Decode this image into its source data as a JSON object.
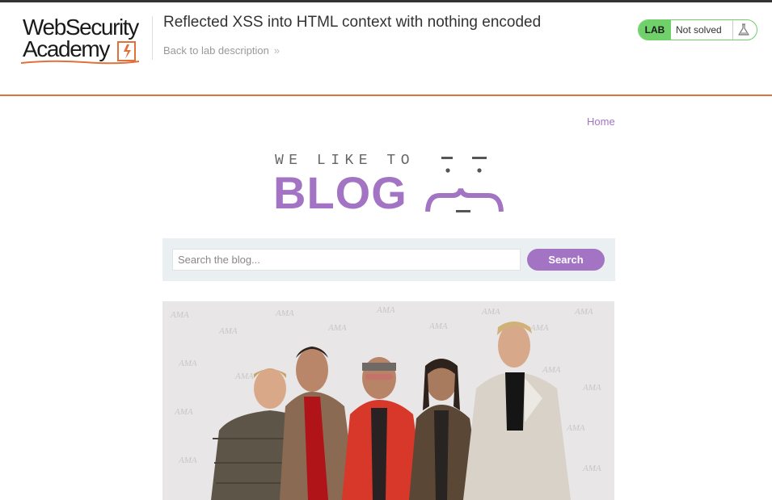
{
  "header": {
    "logo_line1": "WebSecurity",
    "logo_line2": "Academy",
    "lab_title": "Reflected XSS into HTML context with nothing encoded",
    "back_link": "Back to lab description",
    "back_chevron": "»",
    "status_badge": "LAB",
    "status_text": "Not solved"
  },
  "nav": {
    "home": "Home"
  },
  "blog_logo": {
    "tagline": "WE LIKE TO",
    "word": "BLOG"
  },
  "search": {
    "placeholder": "Search the blog...",
    "value": "",
    "button_label": "Search"
  },
  "colors": {
    "accent": "#a274c3",
    "header_rule": "#e0703c",
    "status_green": "#70d06a",
    "search_panel": "#eaeff1"
  },
  "icons": [
    "flask-icon",
    "lightning-icon",
    "chevron-right-icon"
  ]
}
